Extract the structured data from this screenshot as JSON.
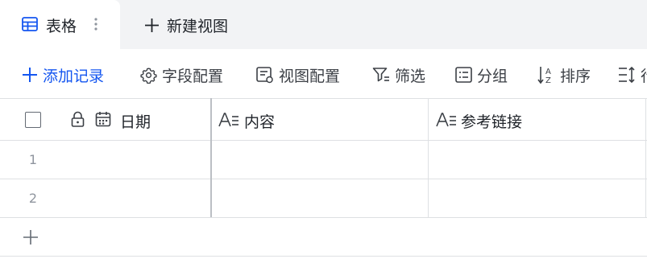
{
  "tabs": {
    "active_label": "表格",
    "new_view_label": "新建视图"
  },
  "toolbar": {
    "add_record": "添加记录",
    "field_config": "字段配置",
    "view_config": "视图配置",
    "filter": "筛选",
    "group": "分组",
    "sort": "排序",
    "row_height_partial": "行"
  },
  "columns": [
    {
      "name": "日期",
      "type_icon": "calendar-icon",
      "locked": true
    },
    {
      "name": "内容",
      "type_icon": "text-field-icon"
    },
    {
      "name": "参考链接",
      "type_icon": "text-field-icon"
    }
  ],
  "rows": [
    {
      "number": "1",
      "cells": [
        "",
        "",
        ""
      ]
    },
    {
      "number": "2",
      "cells": [
        "",
        "",
        ""
      ]
    }
  ],
  "colors": {
    "accent": "#1456f0",
    "tab_bar_bg": "#f2f3f5",
    "grid_line": "#dee0e3"
  }
}
